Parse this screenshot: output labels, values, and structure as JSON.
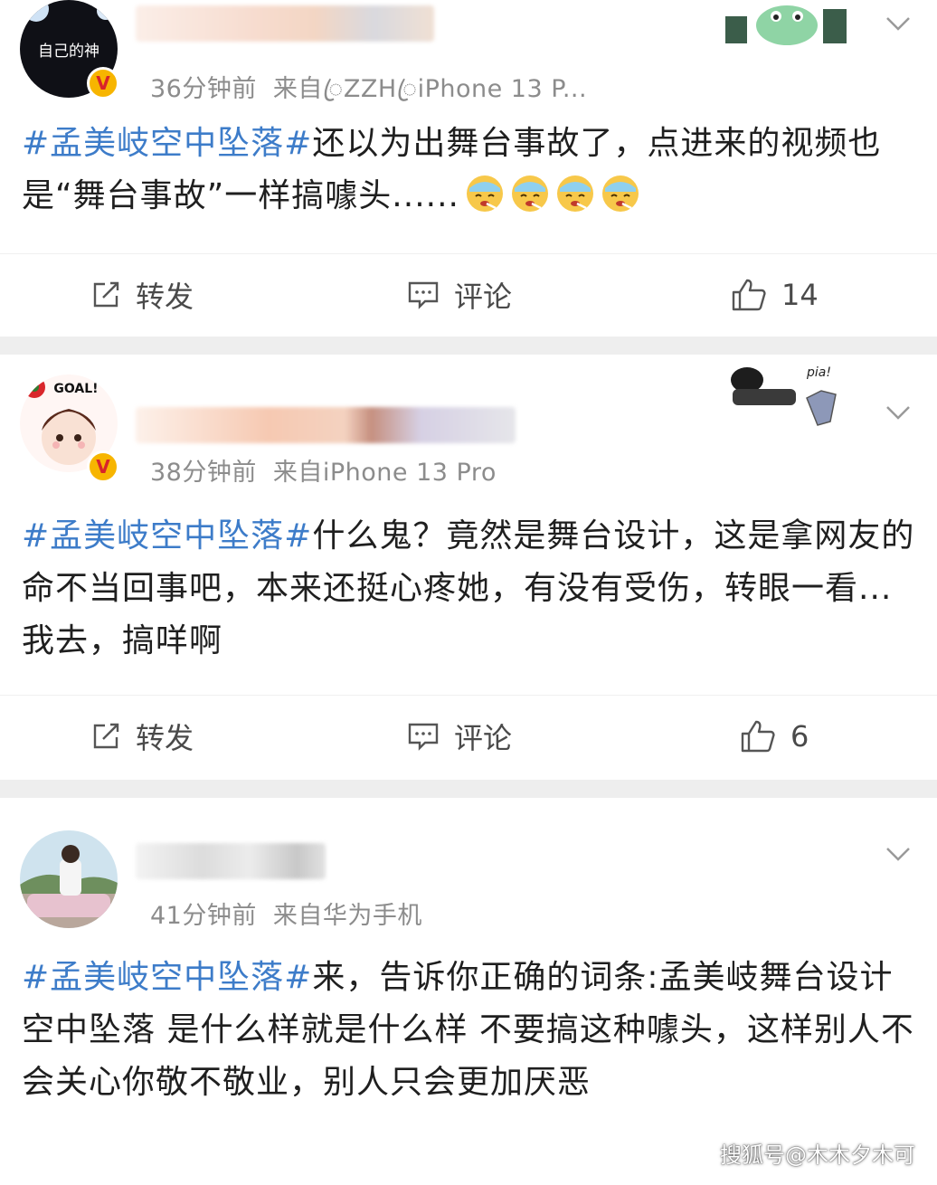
{
  "posts": [
    {
      "time": "36分钟前",
      "source": "来自ꦿZZHꦿiPhone 13 P...",
      "hashtag": "#孟美岐空中坠落#",
      "text": "还以为出舞台事故了，点进来的视频也是“舞台事故”一样搞噱头......",
      "emoji_count": 4,
      "avatar_text": "自己的神",
      "actions": {
        "repost": "转发",
        "comment": "评论",
        "like": "14"
      }
    },
    {
      "time": "38分钟前",
      "source": "来自iPhone 13 Pro",
      "hashtag": "#孟美岐空中坠落#",
      "text": "什么鬼？竟然是舞台设计，这是拿网友的命不当回事吧，本来还挺心疼她，有没有受伤，转眼一看...我去，搞咩啊",
      "avatar_text": "GOAL!",
      "deco_text": "pia!",
      "actions": {
        "repost": "转发",
        "comment": "评论",
        "like": "6"
      }
    },
    {
      "time": "41分钟前",
      "source": "来自华为手机",
      "hashtag": "#孟美岐空中坠落#",
      "text": "来，告诉你正确的词条:孟美岐舞台设计 空中坠落 是什么样就是什么样 不要搞这种噱头，这样别人不会关心你敬不敬业，别人只会更加厌恶"
    }
  ],
  "watermark": "搜狐号@木木夕木可",
  "colors": {
    "hashtag": "#3d7cc9",
    "meta": "#8c8c8c",
    "separator": "#eeeeee",
    "badge": "#f7b500"
  }
}
